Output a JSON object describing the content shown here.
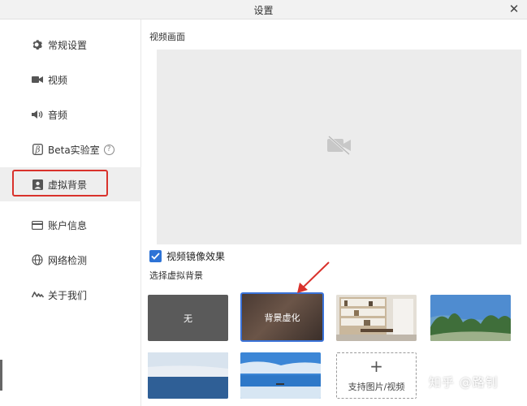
{
  "window": {
    "title": "设置"
  },
  "sidebar": {
    "items": [
      {
        "label": "常规设置",
        "icon": "gear-icon"
      },
      {
        "label": "视频",
        "icon": "video-camera-icon"
      },
      {
        "label": "音频",
        "icon": "speaker-icon"
      },
      {
        "label": "Beta实验室",
        "icon": "beta-icon",
        "help": "?"
      },
      {
        "label": "虚拟背景",
        "icon": "person-portrait-icon",
        "active": true
      },
      {
        "label": "账户信息",
        "icon": "id-card-icon"
      },
      {
        "label": "网络检测",
        "icon": "globe-icon"
      },
      {
        "label": "关于我们",
        "icon": "logo-icon"
      }
    ]
  },
  "main": {
    "preview_title": "视频画面",
    "mirror": {
      "label": "视频镜像效果",
      "checked": true
    },
    "backgrounds_title": "选择虚拟背景",
    "backgrounds": [
      {
        "label": "无"
      },
      {
        "label": "背景虚化",
        "selected": true
      },
      {
        "label": ""
      },
      {
        "label": ""
      },
      {
        "label": ""
      },
      {
        "label": ""
      },
      {
        "label": "支持图片/视频",
        "icon": "plus-icon"
      }
    ]
  },
  "watermark": "知乎 @路钊",
  "colors": {
    "accent": "#2d73d6",
    "annotation": "#d9322c"
  }
}
